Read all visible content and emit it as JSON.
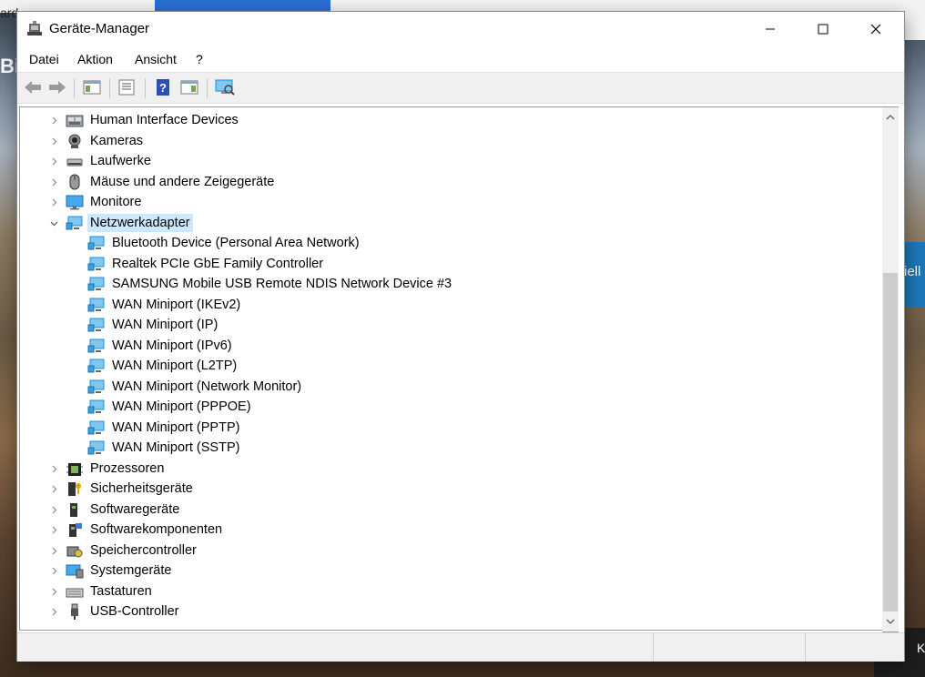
{
  "background": {
    "top_left_text": "ard",
    "left_text": "Bir",
    "right_blue_text": "iell",
    "bottom_right_text": "K"
  },
  "window": {
    "title": "Geräte-Manager",
    "controls": {
      "minimize": "—",
      "maximize": "☐",
      "close": "✕"
    }
  },
  "menu": [
    "Datei",
    "Aktion",
    "Ansicht",
    "?"
  ],
  "toolbar": {
    "buttons": [
      "back-arrow-icon",
      "forward-arrow-icon",
      "show-hide-console-tree-icon",
      "properties-icon",
      "help-icon",
      "action-pane-icon",
      "scan-hardware-icon"
    ]
  },
  "tree": {
    "categories_before": [
      {
        "label": "Human Interface Devices",
        "icon": "hid-icon"
      },
      {
        "label": "Kameras",
        "icon": "camera-icon"
      },
      {
        "label": "Laufwerke",
        "icon": "drive-icon"
      },
      {
        "label": "Mäuse und andere Zeigegeräte",
        "icon": "mouse-icon"
      },
      {
        "label": "Monitore",
        "icon": "monitor-icon"
      }
    ],
    "expanded": {
      "label": "Netzwerkadapter",
      "icon": "network-adapter-icon",
      "children": [
        "Bluetooth Device (Personal Area Network)",
        "Realtek PCIe GbE Family Controller",
        "SAMSUNG Mobile USB Remote NDIS Network Device #3",
        "WAN Miniport (IKEv2)",
        "WAN Miniport (IP)",
        "WAN Miniport (IPv6)",
        "WAN Miniport (L2TP)",
        "WAN Miniport (Network Monitor)",
        "WAN Miniport (PPPOE)",
        "WAN Miniport (PPTP)",
        "WAN Miniport (SSTP)"
      ]
    },
    "categories_after": [
      {
        "label": "Prozessoren",
        "icon": "processor-icon"
      },
      {
        "label": "Sicherheitsgeräte",
        "icon": "security-device-icon"
      },
      {
        "label": "Softwaregeräte",
        "icon": "software-device-icon"
      },
      {
        "label": "Softwarekomponenten",
        "icon": "software-component-icon"
      },
      {
        "label": "Speichercontroller",
        "icon": "storage-controller-icon"
      },
      {
        "label": "Systemgeräte",
        "icon": "system-device-icon"
      },
      {
        "label": "Tastaturen",
        "icon": "keyboard-icon"
      },
      {
        "label": "USB-Controller",
        "icon": "usb-icon"
      }
    ]
  },
  "colors": {
    "selection": "#cce8ff",
    "network_icon": "#1c8fd6"
  }
}
